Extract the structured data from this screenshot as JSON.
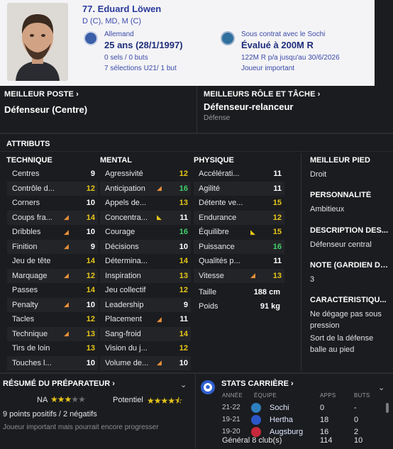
{
  "header": {
    "name": "77. Eduard Löwen",
    "positions": "D (C), MD, M (C)",
    "nationality": "Allemand",
    "age": "25 ans (28/1/1997)",
    "caps": "0 sels / 0 buts",
    "youth_caps": "7 sélections U21/ 1 but",
    "contract": "Sous contrat avec le Sochi",
    "value": "Évalué à 200M R",
    "wage": "122M R p/a jusqu'au 30/6/2026",
    "status": "Joueur important"
  },
  "best_position": {
    "title": "MEILLEUR POSTE",
    "value": "Défenseur (Centre)"
  },
  "best_role": {
    "title": "MEILLEURS RÔLE ET TÂCHE",
    "value": "Défenseur-relanceur",
    "sub": "Défense"
  },
  "attributes": {
    "title": "ATTRIBUTS",
    "technical": {
      "title": "TECHNIQUE",
      "rows": [
        {
          "name": "Centres",
          "value": "9",
          "tone": "w",
          "trend": ""
        },
        {
          "name": "Contrôle d...",
          "value": "12",
          "tone": "y",
          "trend": ""
        },
        {
          "name": "Corners",
          "value": "10",
          "tone": "w",
          "trend": ""
        },
        {
          "name": "Coups fra...",
          "value": "14",
          "tone": "y",
          "trend": "up"
        },
        {
          "name": "Dribbles",
          "value": "10",
          "tone": "w",
          "trend": "up"
        },
        {
          "name": "Finition",
          "value": "9",
          "tone": "w",
          "trend": "up"
        },
        {
          "name": "Jeu de tête",
          "value": "14",
          "tone": "y",
          "trend": ""
        },
        {
          "name": "Marquage",
          "value": "12",
          "tone": "y",
          "trend": "up"
        },
        {
          "name": "Passes",
          "value": "14",
          "tone": "y",
          "trend": ""
        },
        {
          "name": "Penalty",
          "value": "10",
          "tone": "w",
          "trend": "up"
        },
        {
          "name": "Tacles",
          "value": "12",
          "tone": "y",
          "trend": ""
        },
        {
          "name": "Technique",
          "value": "13",
          "tone": "y",
          "trend": "up"
        },
        {
          "name": "Tirs de loin",
          "value": "13",
          "tone": "y",
          "trend": ""
        },
        {
          "name": "Touches l...",
          "value": "10",
          "tone": "w",
          "trend": ""
        }
      ]
    },
    "mental": {
      "title": "MENTAL",
      "rows": [
        {
          "name": "Agressivité",
          "value": "12",
          "tone": "y",
          "trend": ""
        },
        {
          "name": "Anticipation",
          "value": "16",
          "tone": "g",
          "trend": "up"
        },
        {
          "name": "Appels de...",
          "value": "13",
          "tone": "y",
          "trend": ""
        },
        {
          "name": "Concentra...",
          "value": "11",
          "tone": "w",
          "trend": "y"
        },
        {
          "name": "Courage",
          "value": "16",
          "tone": "g",
          "trend": ""
        },
        {
          "name": "Décisions",
          "value": "10",
          "tone": "w",
          "trend": ""
        },
        {
          "name": "Détermina...",
          "value": "14",
          "tone": "y",
          "trend": ""
        },
        {
          "name": "Inspiration",
          "value": "13",
          "tone": "y",
          "trend": ""
        },
        {
          "name": "Jeu collectif",
          "value": "12",
          "tone": "y",
          "trend": ""
        },
        {
          "name": "Leadership",
          "value": "9",
          "tone": "w",
          "trend": ""
        },
        {
          "name": "Placement",
          "value": "11",
          "tone": "w",
          "trend": "up"
        },
        {
          "name": "Sang-froid",
          "value": "14",
          "tone": "y",
          "trend": ""
        },
        {
          "name": "Vision du j...",
          "value": "12",
          "tone": "y",
          "trend": ""
        },
        {
          "name": "Volume de...",
          "value": "10",
          "tone": "w",
          "trend": "up"
        }
      ]
    },
    "physical": {
      "title": "PHYSIQUE",
      "rows": [
        {
          "name": "Accélérati...",
          "value": "11",
          "tone": "w",
          "trend": ""
        },
        {
          "name": "Agilité",
          "value": "11",
          "tone": "w",
          "trend": ""
        },
        {
          "name": "Détente ve...",
          "value": "15",
          "tone": "y",
          "trend": ""
        },
        {
          "name": "Endurance",
          "value": "12",
          "tone": "y",
          "trend": ""
        },
        {
          "name": "Équilibre",
          "value": "15",
          "tone": "y",
          "trend": "y"
        },
        {
          "name": "Puissance",
          "value": "16",
          "tone": "g",
          "trend": ""
        },
        {
          "name": "Qualités p...",
          "value": "11",
          "tone": "w",
          "trend": ""
        },
        {
          "name": "Vitesse",
          "value": "13",
          "tone": "y",
          "trend": "up"
        }
      ],
      "height_label": "Taille",
      "height_value": "188 cm",
      "weight_label": "Poids",
      "weight_value": "91 kg"
    }
  },
  "side": {
    "foot_title": "MEILLEUR PIED",
    "foot_value": "Droit",
    "personality_title": "PERSONNALITÉ",
    "personality_value": "Ambitieux",
    "description_title": "DESCRIPTION DES...",
    "description_value": "Défenseur central",
    "gk_title": "NOTE (GARDIEN DE...",
    "gk_value": "3",
    "traits_title": "CARACTÉRISTIQU...",
    "trait1": "Ne dégage pas sous pression",
    "trait2": "Sort de la défense balle au pied"
  },
  "summary": {
    "title": "RÉSUMÉ DU PRÉPARATEUR",
    "na_label": "NA",
    "na_stars": 3,
    "potential_label": "Potentiel",
    "potential_stars": 4.5,
    "points": "9 points positifs / 2 négatifs",
    "note": "Joueur important mais pourrait encore progresser"
  },
  "career": {
    "title": "STATS CARRIÈRE",
    "headers": {
      "year": "ANNÉE",
      "club": "ÉQUIPE",
      "apps": "APPS",
      "goals": "BUTS"
    },
    "rows": [
      {
        "year": "21-22",
        "club": "Sochi",
        "apps": "0",
        "goals": "-",
        "color": "#2e7fbf"
      },
      {
        "year": "19-21",
        "club": "Hertha",
        "apps": "18",
        "goals": "0",
        "color": "#2b57c8"
      },
      {
        "year": "19-20",
        "club": "Augsburg",
        "apps": "16",
        "goals": "2",
        "color": "#c8283c"
      }
    ],
    "total_label": "Général 8 club(s)",
    "total_apps": "114",
    "total_goals": "10"
  }
}
